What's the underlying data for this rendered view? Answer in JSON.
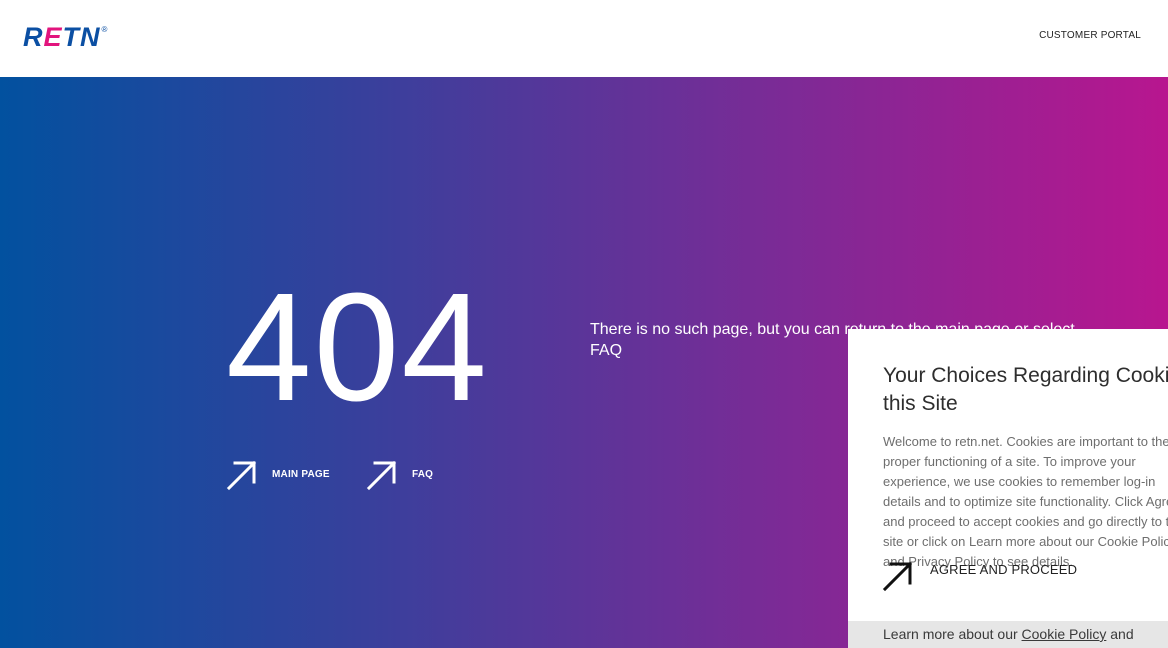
{
  "header": {
    "logo": {
      "letters_r": "R",
      "letters_e": "E",
      "letters_tn": "TN",
      "registered": "®"
    },
    "customer_portal_label": "CUSTOMER PORTAL"
  },
  "hero": {
    "error_code": "404",
    "message": "There is no such page, but you can return to the main page or select FAQ",
    "links": [
      {
        "label": "MAIN PAGE",
        "icon": "arrow-up-right-icon"
      },
      {
        "label": "FAQ",
        "icon": "arrow-up-right-icon"
      }
    ]
  },
  "cookie_banner": {
    "title": "Your Choices Regarding Cookies on this Site",
    "body": "Welcome to retn.net. Cookies are important to the proper functioning of a site. To improve your experience, we use cookies to remember log-in details and to optimize site functionality. Click Agree and proceed to accept cookies and go directly to the site or click on Learn more about our Cookie Policy and Privacy Policy to see details.",
    "agree_label": "AGREE AND PROCEED",
    "footer_prefix": "Learn more about our",
    "cookie_policy_link": "Cookie Policy",
    "footer_and": "and"
  },
  "colors": {
    "brand_blue": "#0b4fa3",
    "brand_magenta": "#e2147d",
    "gradient_start": "#02519f",
    "gradient_end": "#b8168f"
  }
}
